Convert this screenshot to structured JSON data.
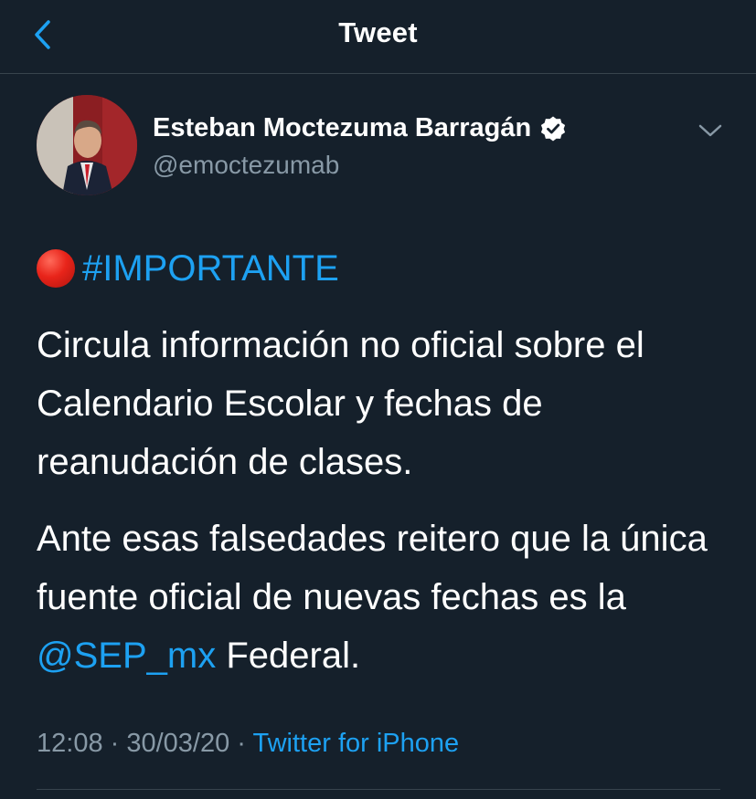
{
  "header": {
    "title": "Tweet",
    "back_icon": "chevron-left-icon"
  },
  "author": {
    "name": "Esteban Moctezuma Barragán",
    "handle": "@emoctezumab",
    "verified_icon": "verified-badge-icon",
    "menu_icon": "chevron-down-icon"
  },
  "tweet": {
    "emoji": "🔴",
    "hashtag": "#IMPORTANTE",
    "paragraph1": "Circula información no oficial sobre el Calendario Escolar y fechas de reanudación de clases.",
    "paragraph2_text": "Ante esas falsedades reitero que la única fuente oficial de nuevas fechas es la ",
    "mention": "@SEP_mx",
    "paragraph2_tail": " Federal."
  },
  "meta": {
    "time": "12:08",
    "sep1": " · ",
    "date": "30/03/20",
    "sep2": " · ",
    "source": "Twitter for iPhone"
  },
  "colors": {
    "background": "#15202b",
    "accent": "#1da1f2",
    "secondary_text": "#8899a6",
    "divider": "#38444d"
  }
}
